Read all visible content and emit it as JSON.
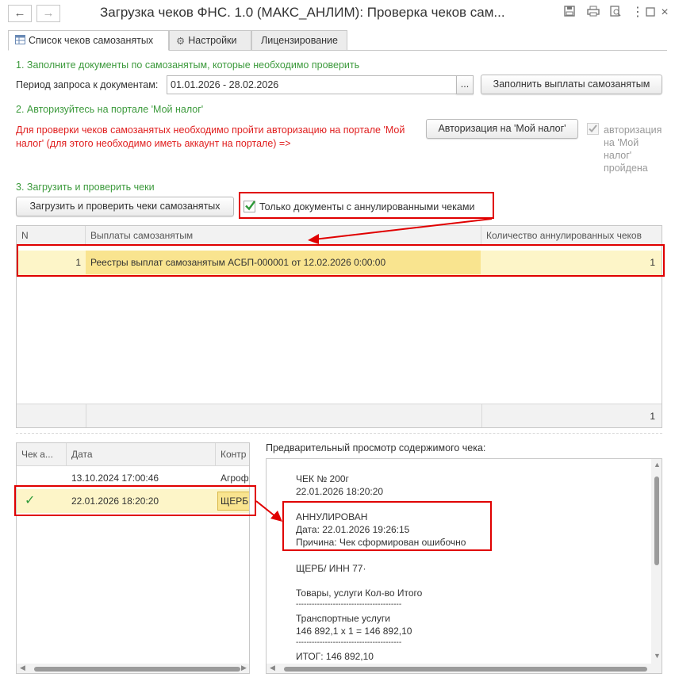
{
  "window": {
    "title": "Загрузка чеков ФНС. 1.0 (МАКС_АНЛИМ): Проверка чеков сам...",
    "back_glyph": "🡐",
    "forward_glyph": "🡒",
    "icons": [
      "save-icon",
      "print-icon",
      "preview-icon",
      "more-icon",
      "maximize-icon",
      "close-icon"
    ]
  },
  "tabs": [
    {
      "label": "Список чеков самозанятых",
      "icon": "table-icon"
    },
    {
      "label": "Настройки",
      "icon": "gear-icon"
    },
    {
      "label": "Лицензирование"
    }
  ],
  "step1": {
    "heading": "1. Заполните документы по самозанятым, которые необходимо проверить",
    "period_label": "Период запроса к документам:",
    "period_value": "01.01.2026 - 28.02.2026",
    "period_button": "...",
    "fill_button": "Заполнить выплаты самозанятым"
  },
  "step2": {
    "heading": "2. Авторизуйтесь на портале 'Мой налог'",
    "warning_line1": "Для проверки чеков самозанятых необходимо пройти авторизацию на портале 'Мой",
    "warning_line2": "налог' (для этого необходимо иметь аккаунт на портале) =>",
    "auth_button": "Авторизация на 'Мой налог'",
    "auth_done_lines": [
      "авторизация",
      "на 'Мой",
      "налог'",
      "пройдена"
    ]
  },
  "step3": {
    "heading": "3. Загрузить и проверить чеки",
    "load_button": "Загрузить и проверить чеки самозанятых",
    "only_annulled_label": "Только документы с аннулированными чеками",
    "only_annulled_checked": true
  },
  "payments_table": {
    "columns": [
      "N",
      "Выплаты самозанятым",
      "Количество аннулированных чеков"
    ],
    "rows": [
      {
        "n": "1",
        "doc": "Реестры выплат самозанятым АСБП-000001 от 12.02.2026 0:00:00",
        "count": "1"
      }
    ],
    "footer_total": "1"
  },
  "checks_table": {
    "columns": [
      "Чек а...",
      "Дата",
      "Контр"
    ],
    "rows": [
      {
        "annulled": false,
        "date": "13.10.2024 17:00:46",
        "contractor": "Агроф"
      },
      {
        "annulled": true,
        "date": "22.01.2026 18:20:20",
        "contractor": "ЩЕРБ"
      }
    ]
  },
  "preview": {
    "label": "Предварительный просмотр содержимого чека:",
    "lines": [
      "ЧЕК № 200г",
      "22.01.2026 18:20:20",
      "",
      "АННУЛИРОВАН",
      "Дата: 22.01.2026 19:26:15",
      "Причина: Чек сформирован ошибочно",
      "",
      "ЩЕРБ/               ИНН 77·",
      "",
      "Товары, услуги     Кол-во        Итого",
      "----------------------------------------",
      "Транспортные услуги",
      "           146 892,1 x 1 = 146 892,10",
      "----------------------------------------",
      "ИТОГ:                          146 892,10"
    ]
  },
  "colors": {
    "green_heading": "#3c9a3c",
    "red_warning": "#e02020",
    "highlight_row": "#fdf5c8",
    "selected_cell": "#f9e48f",
    "annotation_red": "#e00000"
  }
}
